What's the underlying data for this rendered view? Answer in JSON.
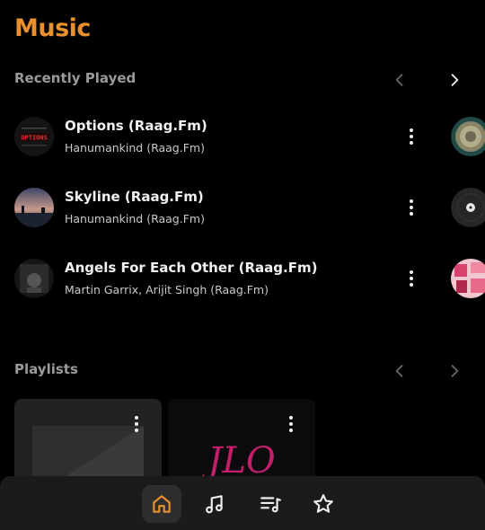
{
  "app": {
    "title": "Music",
    "accent": "#e8902e"
  },
  "recently_played": {
    "title": "Recently Played",
    "tracks": [
      {
        "title": "Options (Raag.Fm)",
        "artist": "Hanumankind (Raag.Fm)",
        "art_text": "OPTIONS"
      },
      {
        "title": "Skyline (Raag.Fm)",
        "artist": "Hanumankind (Raag.Fm)"
      },
      {
        "title": "Angels For Each Other (Raag.Fm)",
        "artist": "Martin Garrix, Arijit Singh (Raag.Fm)"
      }
    ]
  },
  "playlists": {
    "title": "Playlists",
    "second_card_text": "JLO"
  },
  "bottom_nav": {
    "items": [
      {
        "name": "home",
        "icon": "home-icon",
        "active": true
      },
      {
        "name": "songs",
        "icon": "music-note-icon",
        "active": false
      },
      {
        "name": "playlists",
        "icon": "playlist-icon",
        "active": false
      },
      {
        "name": "favorites",
        "icon": "star-icon",
        "active": false
      }
    ]
  }
}
